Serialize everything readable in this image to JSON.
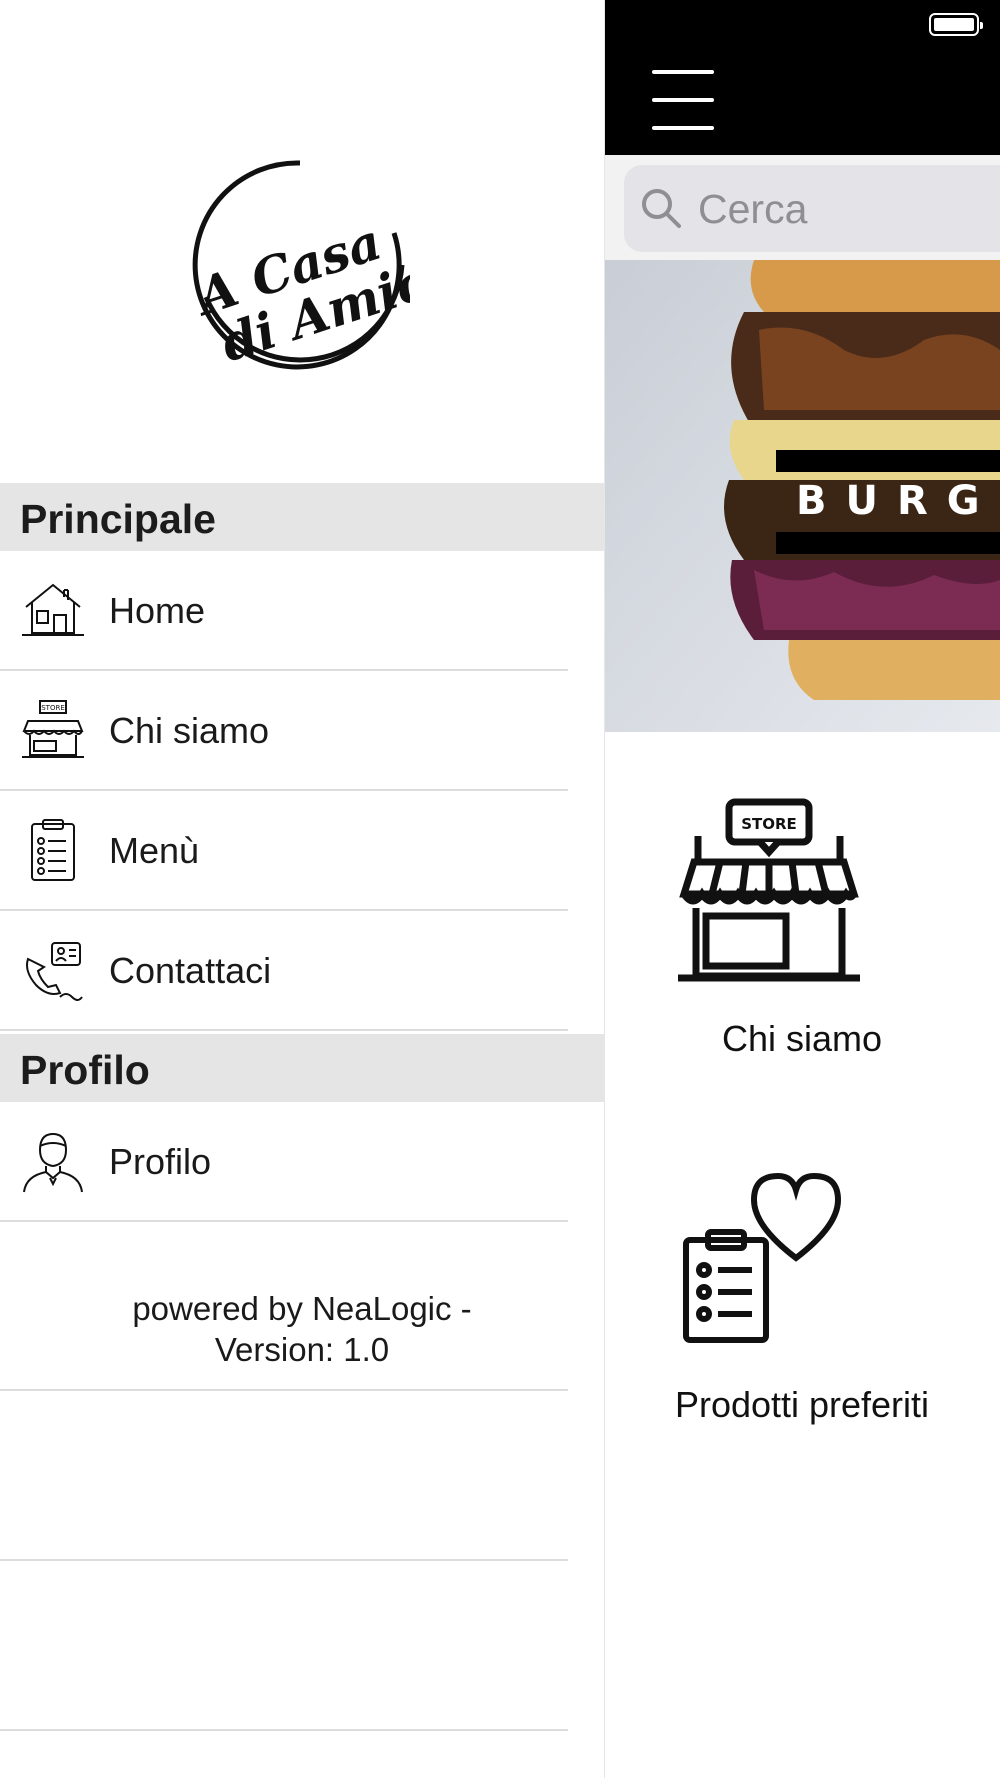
{
  "drawer": {
    "logo": {
      "line1": "A Casa",
      "line2": "di Amici"
    },
    "sections": [
      {
        "title": "Principale",
        "items": [
          {
            "label": "Home",
            "icon": "home-icon"
          },
          {
            "label": "Chi siamo",
            "icon": "store-icon"
          },
          {
            "label": "Menù",
            "icon": "clipboard-list-icon"
          },
          {
            "label": "Contattaci",
            "icon": "contact-phone-icon"
          }
        ]
      },
      {
        "title": "Profilo",
        "items": [
          {
            "label": "Profilo",
            "icon": "user-icon"
          }
        ]
      }
    ],
    "footer": {
      "line1": "powered by NeaLogic -",
      "line2": "Version: 1.0"
    }
  },
  "main": {
    "search": {
      "placeholder": "Cerca"
    },
    "hero": {
      "title": "BURG"
    },
    "tiles": [
      {
        "label": "Chi siamo",
        "icon": "store-icon",
        "icon_text": "STORE"
      },
      {
        "label": "Prodotti preferiti",
        "icon": "favorite-list-icon"
      }
    ]
  },
  "colors": {
    "navbar": "#000000",
    "section_header_bg": "#e5e5e5",
    "divider": "#dcdcdc",
    "search_bg": "#e3e3e8",
    "placeholder": "#8e8e93"
  }
}
